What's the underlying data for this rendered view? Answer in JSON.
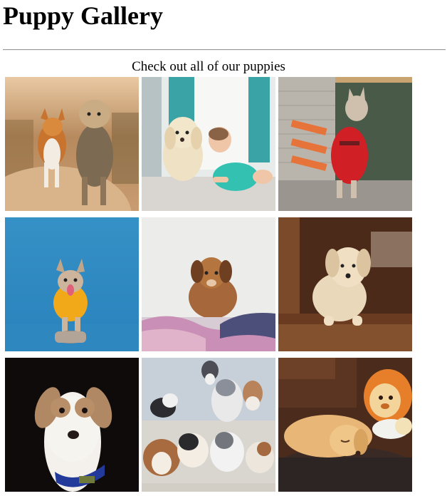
{
  "page": {
    "title": "Puppy Gallery",
    "subtitle": "Check out all of our puppies"
  },
  "gallery": {
    "images": [
      {
        "subject": "corgi and yorkie walking on a path"
      },
      {
        "subject": "poodle puppy next to a crawling baby"
      },
      {
        "subject": "hairless dog in a red hoodie"
      },
      {
        "subject": "french bulldog in yellow sweater with bowl"
      },
      {
        "subject": "brown puppy lying on a blanket"
      },
      {
        "subject": "fluffy terrier lying on the floor"
      },
      {
        "subject": "beagle mix with a blue collar"
      },
      {
        "subject": "australian shepherd puppies"
      },
      {
        "subject": "golden puppy sleeping beside a lion plush"
      }
    ]
  }
}
